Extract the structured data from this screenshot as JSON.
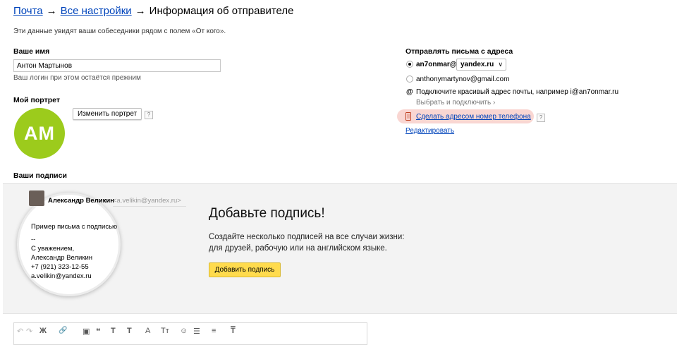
{
  "breadcrumb": {
    "mail": "Почта",
    "arrow1": "→",
    "all_settings": "Все настройки",
    "arrow2": "→",
    "current": "Информация об отправителе"
  },
  "intro": "Эти данные увидят ваши собеседники рядом с полем «От кого».",
  "name_section": {
    "label": "Ваше имя",
    "value": "Антон Мартынов",
    "hint": "Ваш логин при этом остаётся прежним"
  },
  "portrait": {
    "label": "Мой портрет",
    "change_button": "Изменить портрет",
    "help": "?",
    "initials": "AM"
  },
  "send_from": {
    "label": "Отправлять письма с адреса",
    "option1_login": "an7onmar@",
    "option1_domain": "yandex.ru",
    "option2": "anthonymartynov@gmail.com",
    "at_sign": "@",
    "connect_text": "Подключите красивый адрес почты, например i@an7onmar.ru",
    "choose_link": "Выбрать и подключить",
    "choose_chevron": "›",
    "phone_link": "Сделать адресом номер телефона",
    "phone_help": "?",
    "edit_link": "Редактировать"
  },
  "signatures": {
    "label": "Ваши подписи",
    "example": {
      "name": "Александр Великин",
      "email": "<a.velikin@yandex.ru>",
      "lines": [
        "Пример письма с подписью",
        "--",
        "С уважением,",
        "Александр Великин",
        "+7 (921) 323-12-55",
        "a.velikin@yandex.ru"
      ]
    },
    "title": "Добавьте подпись!",
    "desc_line1": "Создайте несколько подписей на все случаи жизни:",
    "desc_line2": "для друзей, рабочую или на английском языке.",
    "add_button": "Добавить подпись"
  },
  "toolbar": {
    "undo": "↶",
    "redo": "↷",
    "bold": "Ж",
    "link": "🔗",
    "image": "▣",
    "quote": "❝",
    "text": "T",
    "format": "T",
    "font": "A",
    "size": "Tт",
    "emoji": "☺",
    "list": "☰",
    "align": "≡",
    "clear": "T"
  },
  "colors": {
    "link": "#0044bb",
    "avatar": "#9ccb1c",
    "add_button": "#ffdb4d",
    "phone_highlight": "#f9d6d2"
  }
}
